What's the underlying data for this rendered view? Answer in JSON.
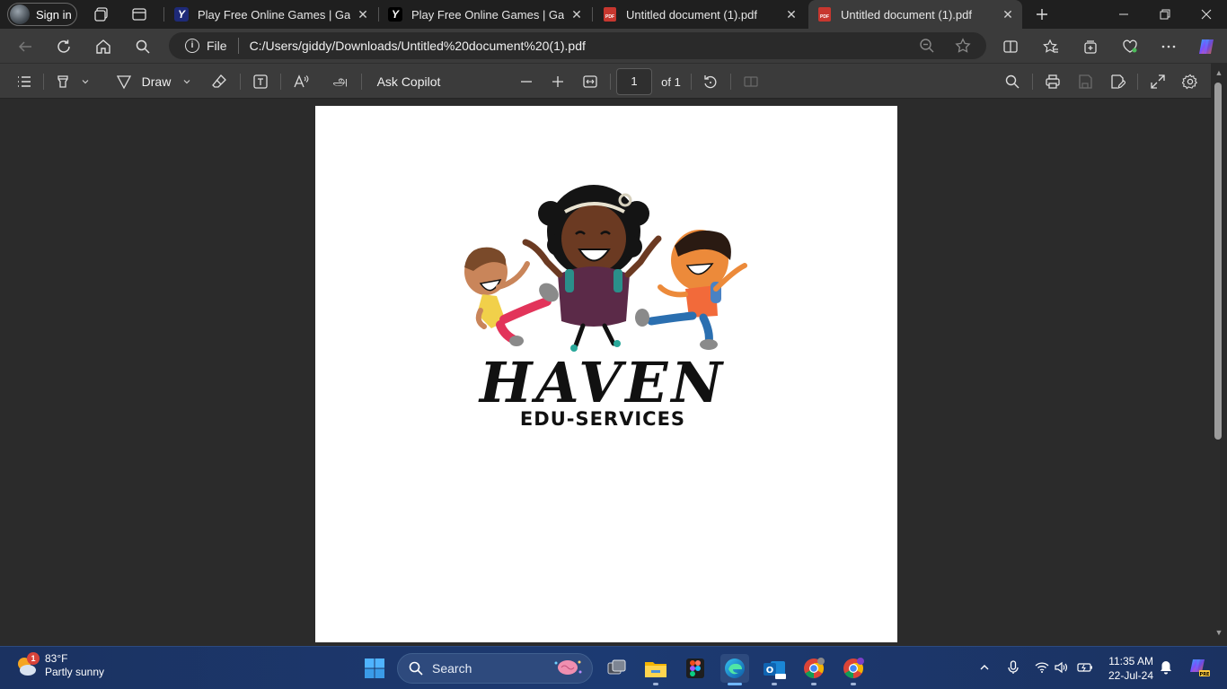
{
  "browser": {
    "signin_label": "Sign in",
    "tabs": [
      {
        "title": "Play Free Online Games | Games",
        "favicon": "y8-icon",
        "active": false
      },
      {
        "title": "Play Free Online Games | Games",
        "favicon": "y8-icon",
        "active": false
      },
      {
        "title": "Untitled document (1).pdf",
        "favicon": "pdf-icon",
        "active": false
      },
      {
        "title": "Untitled document (1).pdf",
        "favicon": "pdf-icon",
        "active": true
      }
    ],
    "pdf_favicon_text": "PDF",
    "address": {
      "scheme": "File",
      "url": "C:/Users/giddy/Downloads/Untitled%20document%20(1).pdf"
    }
  },
  "pdf_toolbar": {
    "draw_label": "Draw",
    "ask_copilot_label": "Ask Copilot",
    "page_current": "1",
    "page_total_label": "of 1"
  },
  "document": {
    "logo_title": "HAVEN",
    "logo_subtitle": "EDU-SERVICES"
  },
  "taskbar": {
    "weather_badge": "1",
    "weather_temp": "83°F",
    "weather_desc": "Partly sunny",
    "search_label": "Search",
    "time": "11:35 AM",
    "date": "22-Jul-24"
  },
  "colors": {
    "tabstrip_bg": "#1f1f1f",
    "toolbar_bg": "#3b3b3b",
    "doc_bg": "#2b2b2b",
    "taskbar_bg": "#1c3a72",
    "accent": "#4aa3ff"
  }
}
